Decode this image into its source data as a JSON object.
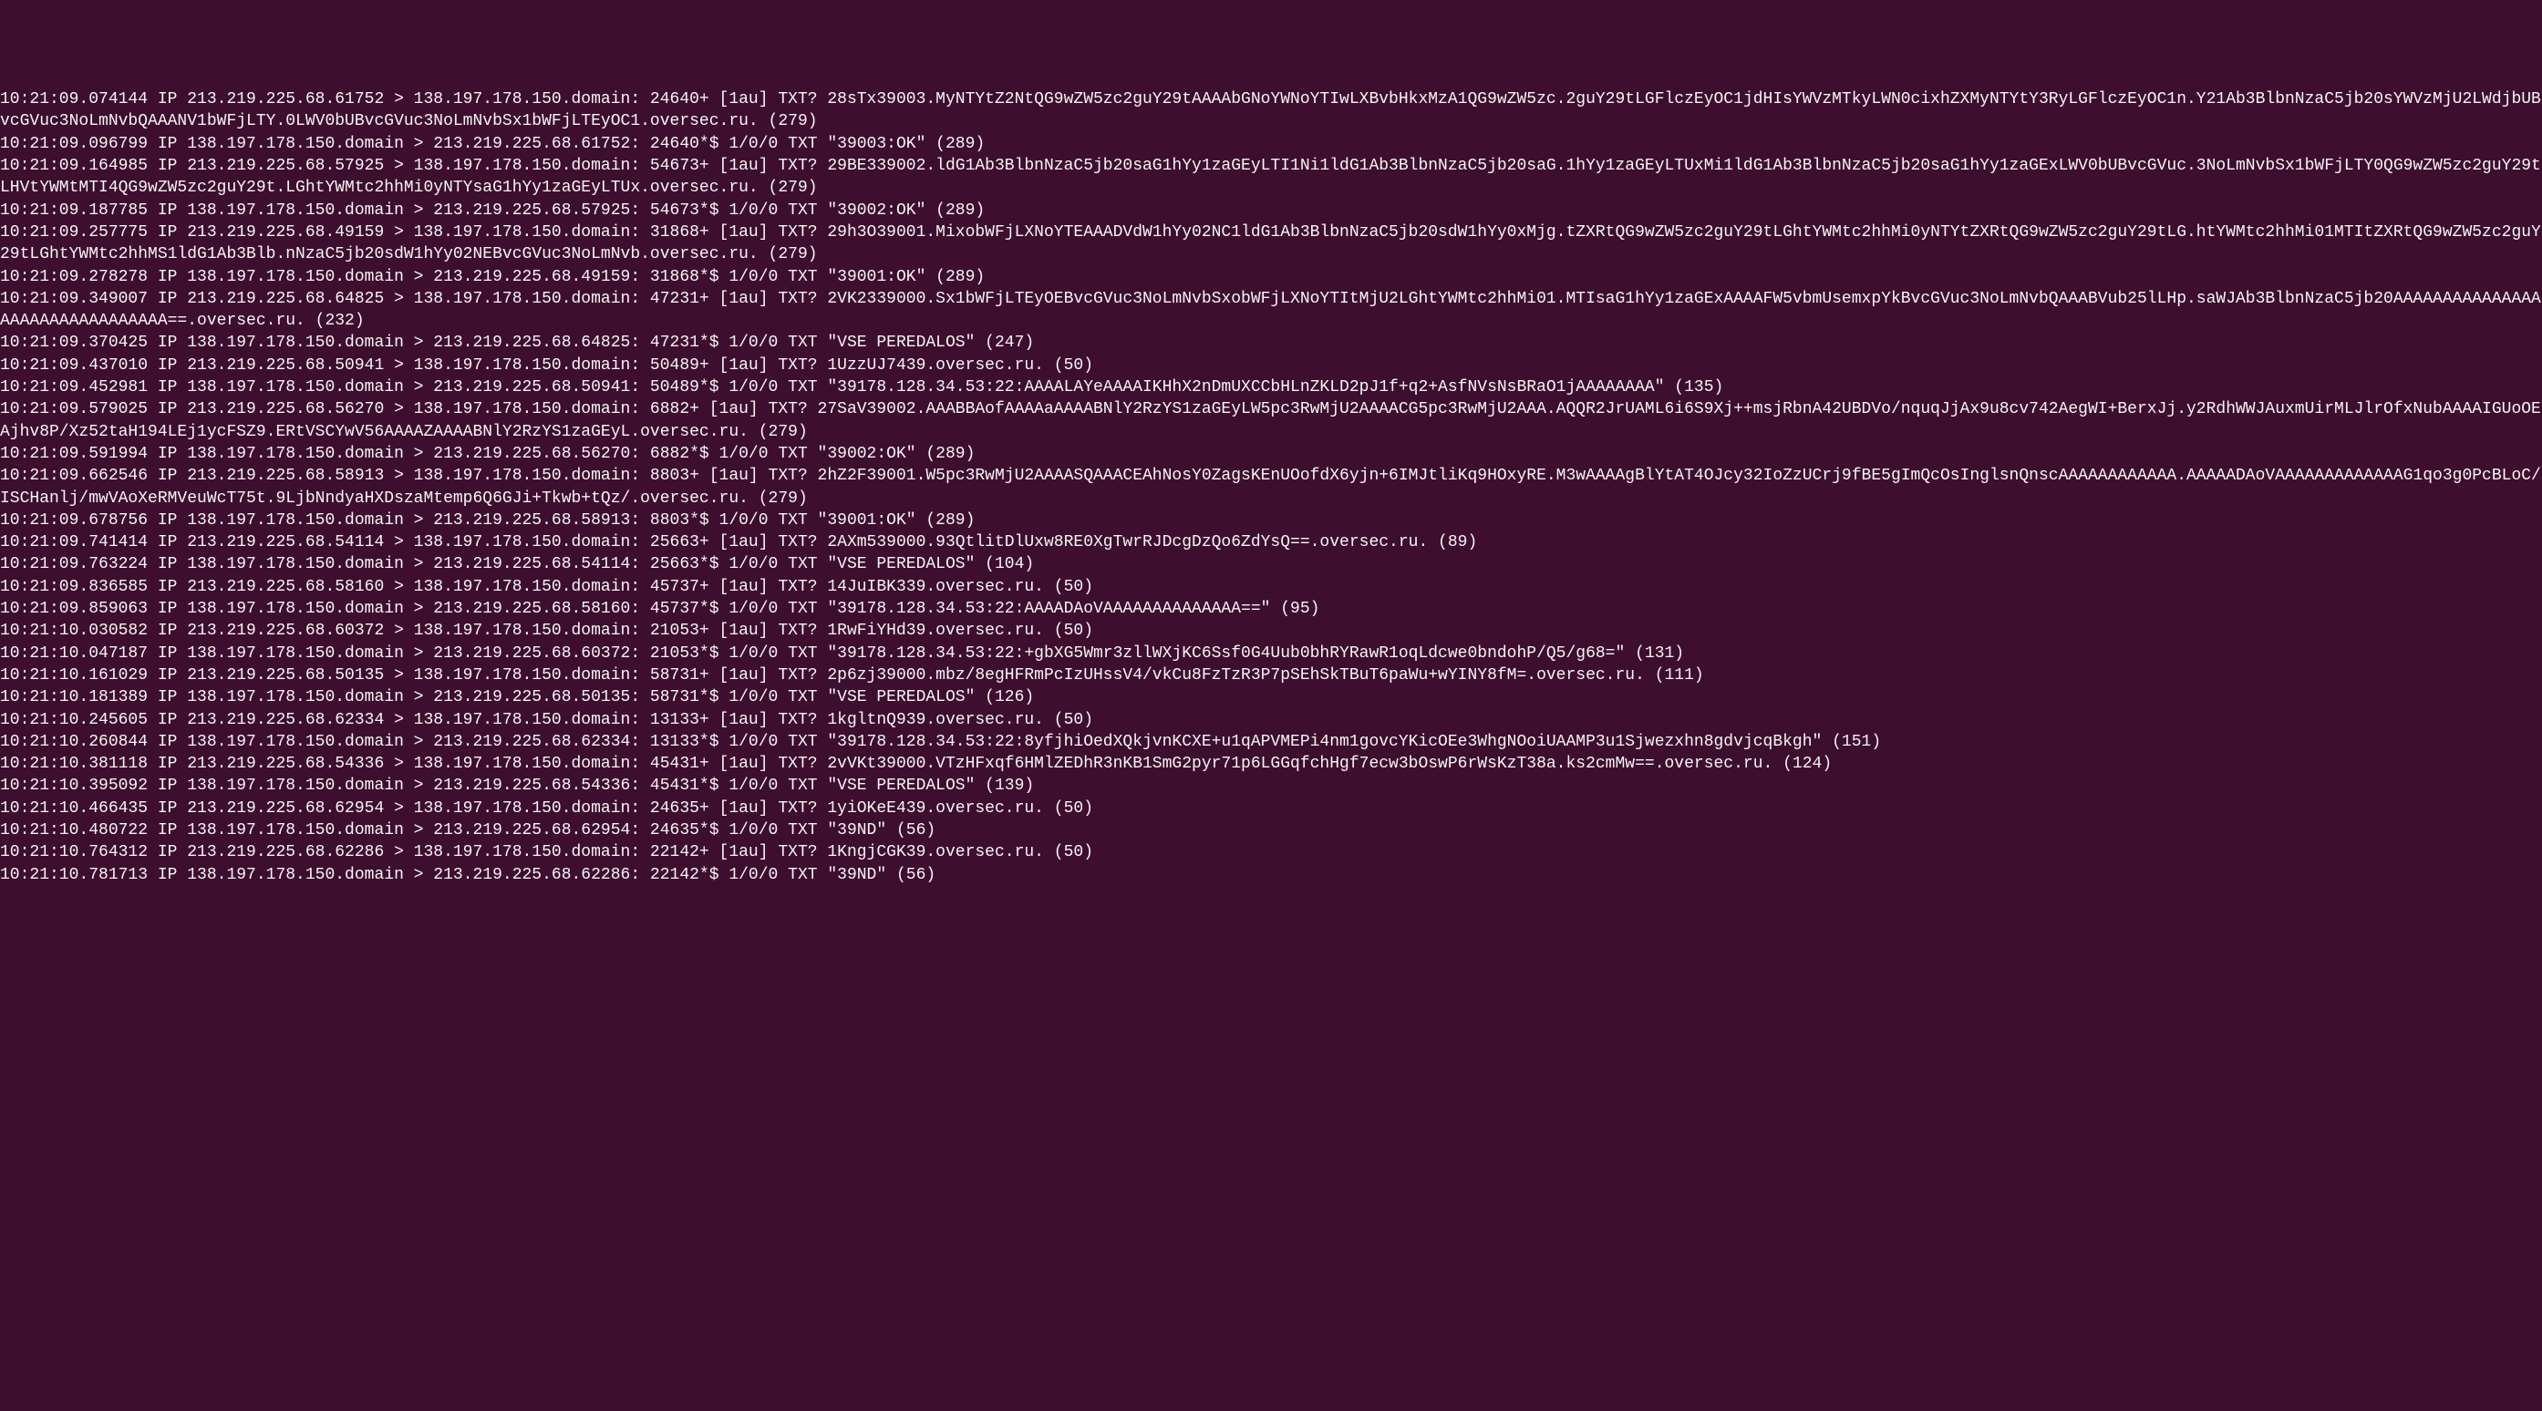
{
  "lines": [
    "10:21:09.074144 IP 213.219.225.68.61752 > 138.197.178.150.domain: 24640+ [1au] TXT? 28sTx39003.MyNTYtZ2NtQG9wZW5zc2guY29tAAAAbGNoYWNoYTIwLXBvbHkxMzA1QG9wZW5zc.2guY29tLGFlczEyOC1jdHIsYWVzMTkyLWN0cixhZXMyNTYtY3RyLGFlczEyOC1n.Y21Ab3BlbnNzaC5jb20sYWVzMjU2LWdjbUBvcGVuc3NoLmNvbQAAANV1bWFjLTY.0LWV0bUBvcGVuc3NoLmNvbSx1bWFjLTEyOC1.oversec.ru. (279)",
    "10:21:09.096799 IP 138.197.178.150.domain > 213.219.225.68.61752: 24640*$ 1/0/0 TXT \"39003:OK\" (289)",
    "10:21:09.164985 IP 213.219.225.68.57925 > 138.197.178.150.domain: 54673+ [1au] TXT? 29BE339002.ldG1Ab3BlbnNzaC5jb20saG1hYy1zaGEyLTI1Ni1ldG1Ab3BlbnNzaC5jb20saG.1hYy1zaGEyLTUxMi1ldG1Ab3BlbnNzaC5jb20saG1hYy1zaGExLWV0bUBvcGVuc.3NoLmNvbSx1bWFjLTY0QG9wZW5zc2guY29tLHVtYWMtMTI4QG9wZW5zc2guY29t.LGhtYWMtc2hhMi0yNTYsaG1hYy1zaGEyLTUx.oversec.ru. (279)",
    "10:21:09.187785 IP 138.197.178.150.domain > 213.219.225.68.57925: 54673*$ 1/0/0 TXT \"39002:OK\" (289)",
    "10:21:09.257775 IP 213.219.225.68.49159 > 138.197.178.150.domain: 31868+ [1au] TXT? 29h3O39001.MixobWFjLXNoYTEAAADVdW1hYy02NC1ldG1Ab3BlbnNzaC5jb20sdW1hYy0xMjg.tZXRtQG9wZW5zc2guY29tLGhtYWMtc2hhMi0yNTYtZXRtQG9wZW5zc2guY29tLG.htYWMtc2hhMi01MTItZXRtQG9wZW5zc2guY29tLGhtYWMtc2hhMS1ldG1Ab3Blb.nNzaC5jb20sdW1hYy02NEBvcGVuc3NoLmNvb.oversec.ru. (279)",
    "10:21:09.278278 IP 138.197.178.150.domain > 213.219.225.68.49159: 31868*$ 1/0/0 TXT \"39001:OK\" (289)",
    "10:21:09.349007 IP 213.219.225.68.64825 > 138.197.178.150.domain: 47231+ [1au] TXT? 2VK2339000.Sx1bWFjLTEyOEBvcGVuc3NoLmNvbSxobWFjLXNoYTItMjU2LGhtYWMtc2hhMi01.MTIsaG1hYy1zaGExAAAAFW5vbmUsemxpYkBvcGVuc3NoLmNvbQAAABVub25lLHp.saWJAb3BlbnNzaC5jb20AAAAAAAAAAAAAAAAAAAAAAAAAAAAAAAA==.oversec.ru. (232)",
    "10:21:09.370425 IP 138.197.178.150.domain > 213.219.225.68.64825: 47231*$ 1/0/0 TXT \"VSE PEREDALOS\" (247)",
    "10:21:09.437010 IP 213.219.225.68.50941 > 138.197.178.150.domain: 50489+ [1au] TXT? 1UzzUJ7439.oversec.ru. (50)",
    "10:21:09.452981 IP 138.197.178.150.domain > 213.219.225.68.50941: 50489*$ 1/0/0 TXT \"39178.128.34.53:22:AAAALAYeAAAAIKHhX2nDmUXCCbHLnZKLD2pJ1f+q2+AsfNVsNsBRaO1jAAAAAAAA\" (135)",
    "10:21:09.579025 IP 213.219.225.68.56270 > 138.197.178.150.domain: 6882+ [1au] TXT? 27SaV39002.AAABBAofAAAAaAAAABNlY2RzYS1zaGEyLW5pc3RwMjU2AAAACG5pc3RwMjU2AAA.AQQR2JrUAML6i6S9Xj++msjRbnA42UBDVo/nquqJjAx9u8cv742AegWI+BerxJj.y2RdhWWJAuxmUirMLJlrOfxNubAAAAIGUoOEAjhv8P/Xz52taH194LEj1ycFSZ9.ERtVSCYwV56AAAAZAAAABNlY2RzYS1zaGEyL.oversec.ru. (279)",
    "10:21:09.591994 IP 138.197.178.150.domain > 213.219.225.68.56270: 6882*$ 1/0/0 TXT \"39002:OK\" (289)",
    "10:21:09.662546 IP 213.219.225.68.58913 > 138.197.178.150.domain: 8803+ [1au] TXT? 2hZ2F39001.W5pc3RwMjU2AAAASQAAACEAhNosY0ZagsKEnUOofdX6yjn+6IMJtliKq9HOxyRE.M3wAAAAgBlYtAT4OJcy32IoZzUCrj9fBE5gImQcOsInglsnQnscAAAAAAAAAAAA.AAAAADAoVAAAAAAAAAAAAAG1qo3g0PcBLoC/ISCHanlj/mwVAoXeRMVeuWcT75t.9LjbNndyaHXDszaMtemp6Q6GJi+Tkwb+tQz/.oversec.ru. (279)",
    "10:21:09.678756 IP 138.197.178.150.domain > 213.219.225.68.58913: 8803*$ 1/0/0 TXT \"39001:OK\" (289)",
    "10:21:09.741414 IP 213.219.225.68.54114 > 138.197.178.150.domain: 25663+ [1au] TXT? 2AXm539000.93QtlitDlUxw8RE0XgTwrRJDcgDzQo6ZdYsQ==.oversec.ru. (89)",
    "10:21:09.763224 IP 138.197.178.150.domain > 213.219.225.68.54114: 25663*$ 1/0/0 TXT \"VSE PEREDALOS\" (104)",
    "10:21:09.836585 IP 213.219.225.68.58160 > 138.197.178.150.domain: 45737+ [1au] TXT? 14JuIBK339.oversec.ru. (50)",
    "10:21:09.859063 IP 138.197.178.150.domain > 213.219.225.68.58160: 45737*$ 1/0/0 TXT \"39178.128.34.53:22:AAAADAoVAAAAAAAAAAAAAA==\" (95)",
    "10:21:10.030582 IP 213.219.225.68.60372 > 138.197.178.150.domain: 21053+ [1au] TXT? 1RwFiYHd39.oversec.ru. (50)",
    "10:21:10.047187 IP 138.197.178.150.domain > 213.219.225.68.60372: 21053*$ 1/0/0 TXT \"39178.128.34.53:22:+gbXG5Wmr3zllWXjKC6Ssf0G4Uub0bhRYRawR1oqLdcwe0bndohP/Q5/g68=\" (131)",
    "10:21:10.161029 IP 213.219.225.68.50135 > 138.197.178.150.domain: 58731+ [1au] TXT? 2p6zj39000.mbz/8egHFRmPcIzUHssV4/vkCu8FzTzR3P7pSEhSkTBuT6paWu+wYINY8fM=.oversec.ru. (111)",
    "10:21:10.181389 IP 138.197.178.150.domain > 213.219.225.68.50135: 58731*$ 1/0/0 TXT \"VSE PEREDALOS\" (126)",
    "10:21:10.245605 IP 213.219.225.68.62334 > 138.197.178.150.domain: 13133+ [1au] TXT? 1kgltnQ939.oversec.ru. (50)",
    "10:21:10.260844 IP 138.197.178.150.domain > 213.219.225.68.62334: 13133*$ 1/0/0 TXT \"39178.128.34.53:22:8yfjhiOedXQkjvnKCXE+u1qAPVMEPi4nm1govcYKicOEe3WhgNOoiUAAMP3u1Sjwezxhn8gdvjcqBkgh\" (151)",
    "10:21:10.381118 IP 213.219.225.68.54336 > 138.197.178.150.domain: 45431+ [1au] TXT? 2vVKt39000.VTzHFxqf6HMlZEDhR3nKB1SmG2pyr71p6LGGqfchHgf7ecw3bOswP6rWsKzT38a.ks2cmMw==.oversec.ru. (124)",
    "10:21:10.395092 IP 138.197.178.150.domain > 213.219.225.68.54336: 45431*$ 1/0/0 TXT \"VSE PEREDALOS\" (139)",
    "10:21:10.466435 IP 213.219.225.68.62954 > 138.197.178.150.domain: 24635+ [1au] TXT? 1yiOKeE439.oversec.ru. (50)",
    "10:21:10.480722 IP 138.197.178.150.domain > 213.219.225.68.62954: 24635*$ 1/0/0 TXT \"39ND\" (56)",
    "10:21:10.764312 IP 213.219.225.68.62286 > 138.197.178.150.domain: 22142+ [1au] TXT? 1KngjCGK39.oversec.ru. (50)",
    "10:21:10.781713 IP 138.197.178.150.domain > 213.219.225.68.62286: 22142*$ 1/0/0 TXT \"39ND\" (56)"
  ]
}
